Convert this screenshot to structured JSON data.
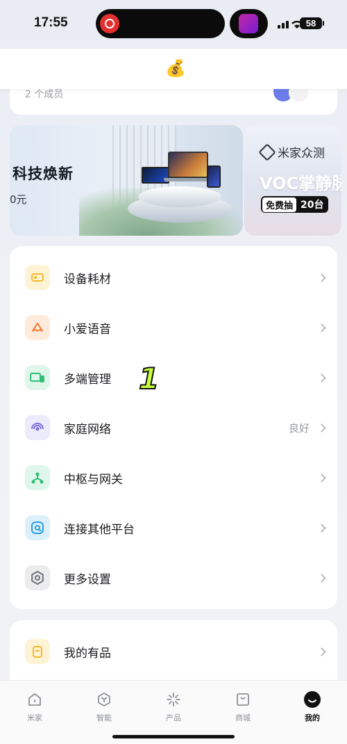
{
  "status_bar": {
    "time": "17:55",
    "battery": "58"
  },
  "header": {
    "money_icon": "💰"
  },
  "family": {
    "members": "2 个成员"
  },
  "banners": {
    "main": {
      "title": "科技焕新",
      "subtitle": "0元"
    },
    "second": {
      "logo": "米家众测",
      "title": "VOC掌静脉",
      "tag_left": "免费抽",
      "tag_right": "20台"
    }
  },
  "settings": {
    "items": [
      {
        "label": "设备耗材",
        "icon": "consumables-icon",
        "value": ""
      },
      {
        "label": "小爱语音",
        "icon": "xiaoai-voice-icon",
        "value": ""
      },
      {
        "label": "多端管理",
        "icon": "multi-device-icon",
        "value": ""
      },
      {
        "label": "家庭网络",
        "icon": "home-network-icon",
        "value": "良好"
      },
      {
        "label": "中枢与网关",
        "icon": "hub-gateway-icon",
        "value": ""
      },
      {
        "label": "连接其他平台",
        "icon": "connect-platform-icon",
        "value": ""
      },
      {
        "label": "更多设置",
        "icon": "more-settings-icon",
        "value": ""
      }
    ]
  },
  "products": {
    "items": [
      {
        "label": "我的有品",
        "icon": "youpin-icon"
      }
    ]
  },
  "overlay": {
    "mark": "1"
  },
  "tab_bar": {
    "tabs": [
      {
        "label": "米家",
        "icon": "home-icon",
        "active": false
      },
      {
        "label": "智能",
        "icon": "smart-icon",
        "active": false
      },
      {
        "label": "产品",
        "icon": "product-icon",
        "active": false
      },
      {
        "label": "商城",
        "icon": "mall-icon",
        "active": false
      },
      {
        "label": "我的",
        "icon": "profile-icon",
        "active": true
      }
    ]
  },
  "colors": {
    "accent_yellow": "#f2b92b",
    "accent_orange": "#f07a3a",
    "accent_green": "#2fbf78",
    "accent_purple": "#7b6fe0",
    "accent_blue": "#2a9ee0",
    "mark_color": "#c6ff3c"
  }
}
